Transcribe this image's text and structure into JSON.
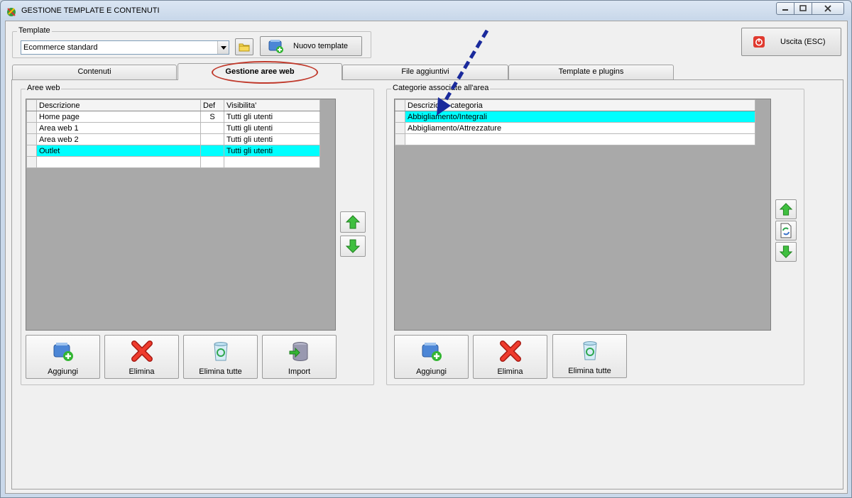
{
  "window": {
    "title": "GESTIONE TEMPLATE E CONTENUTI"
  },
  "template": {
    "legend": "Template",
    "selected": "Ecommerce standard",
    "new_label": "Nuovo template"
  },
  "exit": {
    "label": "Uscita (ESC)"
  },
  "tabs": [
    {
      "label": "Contenuti"
    },
    {
      "label": "Gestione aree web",
      "active": true
    },
    {
      "label": "File aggiuntivi"
    },
    {
      "label": "Template e plugins"
    }
  ],
  "aree_web": {
    "legend": "Aree web",
    "columns": [
      "Descrizione",
      "Def",
      "Visibilita'"
    ],
    "rows": [
      {
        "descrizione": "Home page",
        "def": "S",
        "visibilita": "Tutti gli utenti"
      },
      {
        "descrizione": "Area web 1",
        "def": "",
        "visibilita": "Tutti gli utenti"
      },
      {
        "descrizione": "Area web 2",
        "def": "",
        "visibilita": "Tutti gli utenti"
      },
      {
        "descrizione": "Outlet",
        "def": "",
        "visibilita": "Tutti gli utenti",
        "selected": true
      }
    ],
    "buttons": {
      "add": "Aggiungi",
      "delete": "Elimina",
      "delete_all": "Elimina tutte",
      "import": "Import"
    }
  },
  "categorie": {
    "legend": "Categorie associate all'area",
    "columns": [
      "Descrizione categoria"
    ],
    "rows": [
      {
        "descrizione": "Abbigliamento/Integrali",
        "selected": true
      },
      {
        "descrizione": "Abbigliamento/Attrezzature"
      }
    ],
    "buttons": {
      "add": "Aggiungi",
      "delete": "Elimina",
      "delete_all": "Elimina tutte"
    }
  },
  "colors": {
    "selection": "#00ffff",
    "grid_background": "#a9a9a9",
    "annotation_arrow": "#1a2a9c",
    "annotation_ellipse": "#c0392b"
  }
}
